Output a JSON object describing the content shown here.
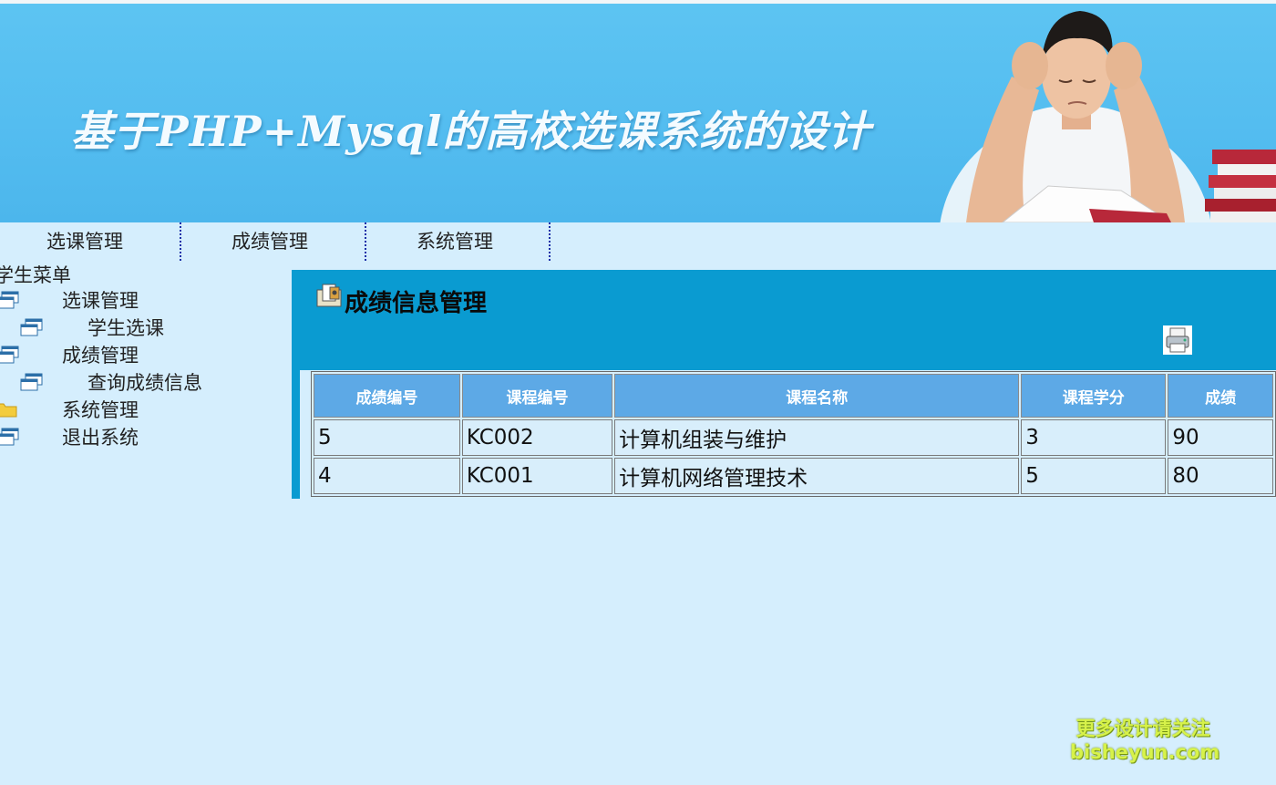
{
  "banner": {
    "title": "基于PHP+Mysql的高校选课系统的设计"
  },
  "nav": {
    "items": [
      {
        "label": "选课管理"
      },
      {
        "label": "成绩管理"
      },
      {
        "label": "系统管理"
      }
    ]
  },
  "sidebar": {
    "title": "学生菜单",
    "items": [
      {
        "label": "选课管理",
        "icon": "window-icon"
      },
      {
        "label": "学生选课",
        "icon": "window-icon"
      },
      {
        "label": "成绩管理",
        "icon": "window-icon"
      },
      {
        "label": "查询成绩信息",
        "icon": "window-icon"
      },
      {
        "label": "系统管理",
        "icon": "folder-icon"
      },
      {
        "label": "退出系统",
        "icon": "window-icon"
      }
    ]
  },
  "panel": {
    "title": "成绩信息管理",
    "print_icon": "printer-icon"
  },
  "table": {
    "columns": [
      "成绩编号",
      "课程编号",
      "课程名称",
      "课程学分",
      "成绩"
    ],
    "rows": [
      [
        "5",
        "KC002",
        "计算机组装与维护",
        "3",
        "90"
      ],
      [
        "4",
        "KC001",
        "计算机网络管理技术",
        "5",
        "80"
      ]
    ]
  },
  "watermark": {
    "line1": "更多设计请关注",
    "line2": "bisheyun.com"
  },
  "colors": {
    "banner": "#55bdf0",
    "page_bg": "#d5eefd",
    "panel": "#0a9bd1",
    "table_header": "#5da9e6",
    "nav_separator": "#1b2fa8",
    "watermark": "#d7f24a"
  }
}
